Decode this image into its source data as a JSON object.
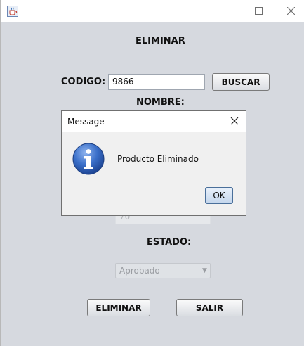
{
  "window": {
    "title": "",
    "icons": {
      "app": "java-cup-icon",
      "minimize": "minimize-icon",
      "maximize": "maximize-icon",
      "close": "close-icon"
    }
  },
  "form": {
    "heading": "ELIMINAR",
    "codigo_label": "CODIGO:",
    "codigo_value": "9866",
    "buscar_label": "BUSCAR",
    "nombre_label": "NOMBRE:",
    "hidden_field_value": "70",
    "estado_label": "ESTADO:",
    "estado_selected": "Aprobado",
    "eliminar_label": "ELIMINAR",
    "salir_label": "SALIR"
  },
  "dialog": {
    "title": "Message",
    "message": "Producto Eliminado",
    "ok_label": "OK",
    "icons": {
      "info": "info-icon",
      "close": "close-icon"
    }
  },
  "colors": {
    "window_bg": "#d6d9df",
    "dialog_bg": "#f0f0f0",
    "info_blue": "#2f62b8",
    "ok_border": "#4a6f9a"
  }
}
